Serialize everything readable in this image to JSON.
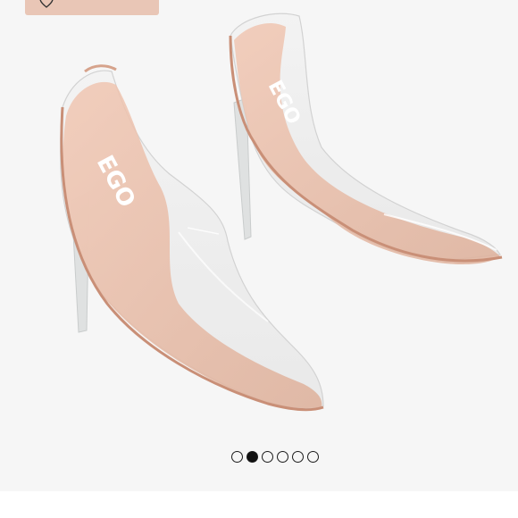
{
  "listing": {
    "like_icon": "heart-icon",
    "brand_text_left": "EGO",
    "brand_text_right": "EGO"
  },
  "carousel": {
    "total": 6,
    "active_index": 1
  },
  "colors": {
    "like_tab": "#e9c6b6",
    "background": "#f6f6f6",
    "nude": "#e7b49c"
  }
}
